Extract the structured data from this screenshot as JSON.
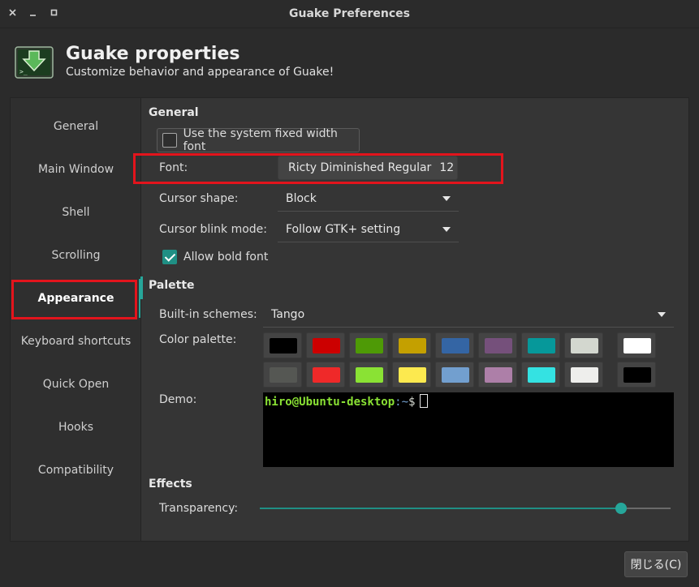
{
  "window": {
    "title": "Guake Preferences"
  },
  "header": {
    "title": "Guake properties",
    "subtitle": "Customize behavior and appearance of Guake!"
  },
  "sidebar": {
    "items": [
      {
        "label": "General"
      },
      {
        "label": "Main Window"
      },
      {
        "label": "Shell"
      },
      {
        "label": "Scrolling"
      },
      {
        "label": "Appearance"
      },
      {
        "label": "Keyboard shortcuts"
      },
      {
        "label": "Quick Open"
      },
      {
        "label": "Hooks"
      },
      {
        "label": "Compatibility"
      }
    ],
    "selected": "Appearance"
  },
  "general": {
    "section_title": "General",
    "system_font_label": "Use the system fixed width font",
    "system_font_checked": false,
    "font_label": "Font:",
    "font_name": "Ricty Diminished Regular",
    "font_size": "12",
    "cursor_shape_label": "Cursor shape:",
    "cursor_shape_value": "Block",
    "cursor_blink_label": "Cursor blink mode:",
    "cursor_blink_value": "Follow GTK+ setting",
    "bold_font_label": "Allow bold font",
    "bold_font_checked": true
  },
  "palette": {
    "section_title": "Palette",
    "builtin_label": "Built-in schemes:",
    "builtin_value": "Tango",
    "color_palette_label": "Color palette:",
    "row1": [
      "#000000",
      "#cc0000",
      "#4e9a06",
      "#c4a000",
      "#3465a4",
      "#75507b",
      "#06989a",
      "#d3d7cf"
    ],
    "row2": [
      "#555753",
      "#ef2929",
      "#8ae234",
      "#fce94f",
      "#729fcf",
      "#ad7fa8",
      "#34e2e2",
      "#eeeeec"
    ],
    "foreground": "#ffffff",
    "background": "#000000",
    "demo_label": "Demo:",
    "demo_user": "hiro@Ubuntu-desktop",
    "demo_path": ":~",
    "demo_prompt": "$"
  },
  "effects": {
    "section_title": "Effects",
    "transparency_label": "Transparency:",
    "transparency_value": 0.88
  },
  "footer": {
    "close_label": "閉じる(C)"
  },
  "colors": {
    "accent": "#26a69a",
    "highlight": "#e3141c"
  }
}
